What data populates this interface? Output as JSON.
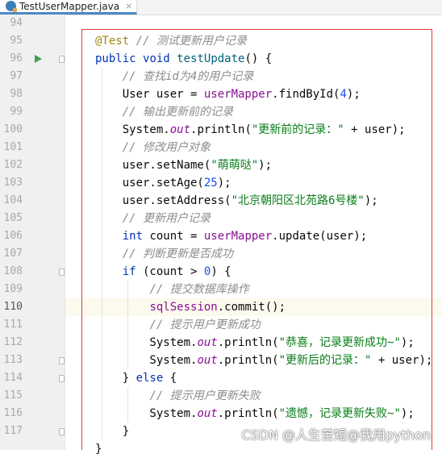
{
  "tab": {
    "filename": "TestUserMapper.java",
    "close": "×"
  },
  "editor": {
    "current_line": "110",
    "lines": [
      {
        "num": "94",
        "parts": []
      },
      {
        "num": "95",
        "parts": [
          {
            "t": "@Test",
            "c": "ann"
          },
          {
            "t": " "
          },
          {
            "t": "// 测试更新用户记录",
            "c": "cmt"
          }
        ]
      },
      {
        "num": "96",
        "parts": [
          {
            "t": "public",
            "c": "kw"
          },
          {
            "t": " "
          },
          {
            "t": "void",
            "c": "kw"
          },
          {
            "t": " "
          },
          {
            "t": "testUpdate",
            "c": "fn"
          },
          {
            "t": "() {"
          }
        ]
      },
      {
        "num": "97",
        "parts": [
          {
            "t": "    "
          },
          {
            "t": "// 查找id为4的用户记录",
            "c": "cmt"
          }
        ]
      },
      {
        "num": "98",
        "parts": [
          {
            "t": "    User user = "
          },
          {
            "t": "userMapper",
            "c": "fld"
          },
          {
            "t": ".findById("
          },
          {
            "t": "4",
            "c": "num"
          },
          {
            "t": ");"
          }
        ]
      },
      {
        "num": "99",
        "parts": [
          {
            "t": "    "
          },
          {
            "t": "// 输出更新前的记录",
            "c": "cmt"
          }
        ]
      },
      {
        "num": "100",
        "parts": [
          {
            "t": "    System."
          },
          {
            "t": "out",
            "c": "fldi"
          },
          {
            "t": ".println("
          },
          {
            "t": "\"更新前的记录：\"",
            "c": "str"
          },
          {
            "t": " + user);"
          }
        ]
      },
      {
        "num": "101",
        "parts": [
          {
            "t": "    "
          },
          {
            "t": "// 修改用户对象",
            "c": "cmt"
          }
        ]
      },
      {
        "num": "102",
        "parts": [
          {
            "t": "    user.setName("
          },
          {
            "t": "\"萌萌哒\"",
            "c": "str"
          },
          {
            "t": ");"
          }
        ]
      },
      {
        "num": "103",
        "parts": [
          {
            "t": "    user.setAge("
          },
          {
            "t": "25",
            "c": "num"
          },
          {
            "t": ");"
          }
        ]
      },
      {
        "num": "104",
        "parts": [
          {
            "t": "    user.setAddress("
          },
          {
            "t": "\"北京朝阳区北苑路6号楼\"",
            "c": "str"
          },
          {
            "t": ");"
          }
        ]
      },
      {
        "num": "105",
        "parts": [
          {
            "t": "    "
          },
          {
            "t": "// 更新用户记录",
            "c": "cmt"
          }
        ]
      },
      {
        "num": "106",
        "parts": [
          {
            "t": "    "
          },
          {
            "t": "int",
            "c": "kw"
          },
          {
            "t": " count = "
          },
          {
            "t": "userMapper",
            "c": "fld"
          },
          {
            "t": ".update(user);"
          }
        ]
      },
      {
        "num": "107",
        "parts": [
          {
            "t": "    "
          },
          {
            "t": "// 判断更新是否成功",
            "c": "cmt"
          }
        ]
      },
      {
        "num": "108",
        "parts": [
          {
            "t": "    "
          },
          {
            "t": "if",
            "c": "kw"
          },
          {
            "t": " (count > "
          },
          {
            "t": "0",
            "c": "num"
          },
          {
            "t": ") {"
          }
        ]
      },
      {
        "num": "109",
        "parts": [
          {
            "t": "        "
          },
          {
            "t": "// 提交数据库操作",
            "c": "cmt"
          }
        ]
      },
      {
        "num": "110",
        "parts": [
          {
            "t": "        "
          },
          {
            "t": "sqlSession",
            "c": "fld"
          },
          {
            "t": ".commit();"
          }
        ]
      },
      {
        "num": "111",
        "parts": [
          {
            "t": "        "
          },
          {
            "t": "// 提示用户更新成功",
            "c": "cmt"
          }
        ]
      },
      {
        "num": "112",
        "parts": [
          {
            "t": "        System."
          },
          {
            "t": "out",
            "c": "fldi"
          },
          {
            "t": ".println("
          },
          {
            "t": "\"恭喜，记录更新成功~\"",
            "c": "str"
          },
          {
            "t": ");"
          }
        ]
      },
      {
        "num": "113",
        "parts": [
          {
            "t": "        System."
          },
          {
            "t": "out",
            "c": "fldi"
          },
          {
            "t": ".println("
          },
          {
            "t": "\"更新后的记录：\"",
            "c": "str"
          },
          {
            "t": " + user);"
          }
        ]
      },
      {
        "num": "114",
        "parts": [
          {
            "t": "    } "
          },
          {
            "t": "else",
            "c": "kw"
          },
          {
            "t": " {"
          }
        ]
      },
      {
        "num": "115",
        "parts": [
          {
            "t": "        "
          },
          {
            "t": "// 提示用户更新失败",
            "c": "cmt"
          }
        ]
      },
      {
        "num": "116",
        "parts": [
          {
            "t": "        System."
          },
          {
            "t": "out",
            "c": "fldi"
          },
          {
            "t": ".println("
          },
          {
            "t": "\"遗憾，记录更新失败~\"",
            "c": "str"
          },
          {
            "t": ");"
          }
        ]
      },
      {
        "num": "117",
        "parts": [
          {
            "t": "    }"
          }
        ]
      },
      {
        "num": "",
        "parts": [
          {
            "t": "}"
          }
        ]
      }
    ]
  },
  "watermark": "CSDN @人生苦短@我用python",
  "colors": {
    "highlight_box": "#e03c3c",
    "run_icon": "#499c54",
    "current_line_bg": "#fcfaed"
  }
}
